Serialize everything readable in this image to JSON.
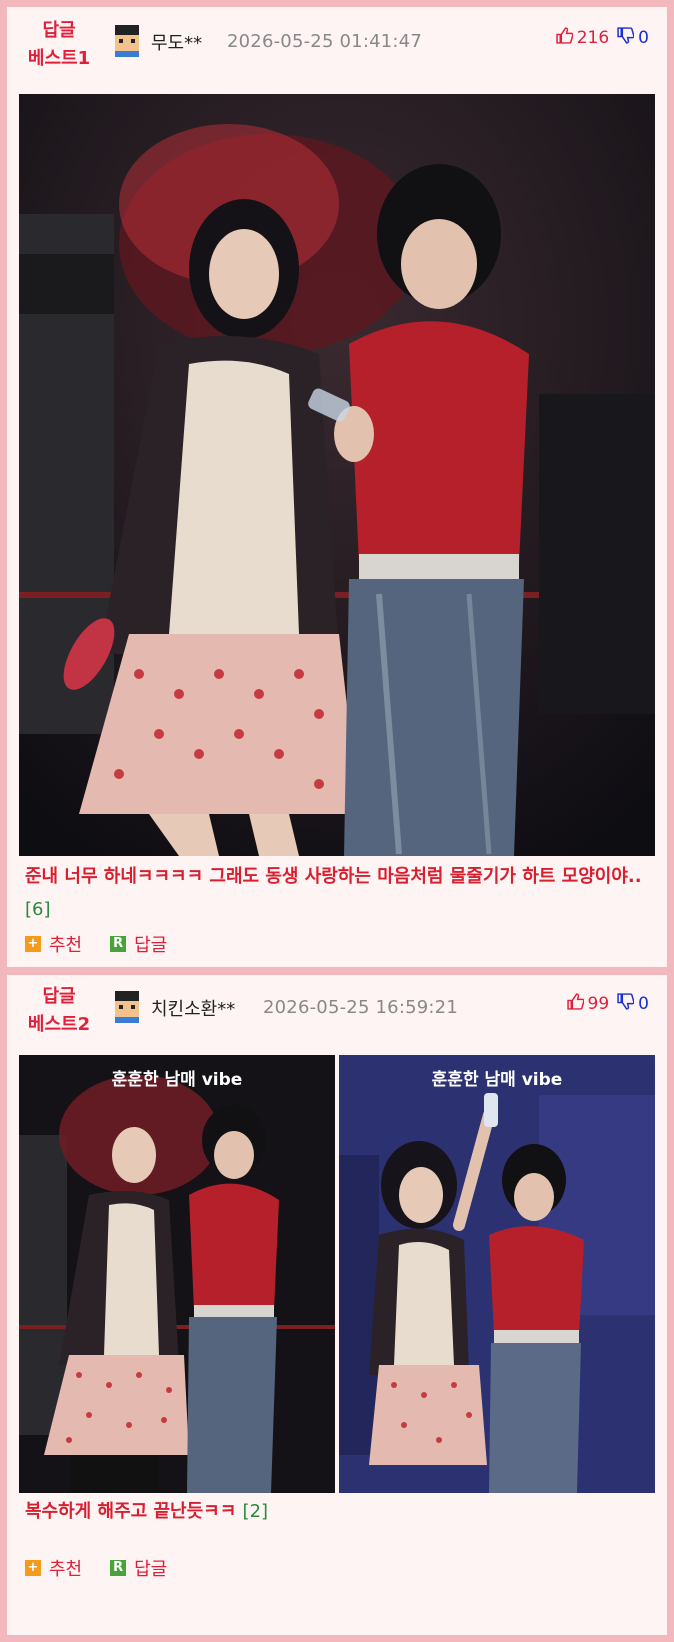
{
  "comments": [
    {
      "badge_line1": "답글",
      "badge_line2": "베스트1",
      "author": "무도**",
      "date": "2026-05-25 01:41:47",
      "up_count": "216",
      "down_count": "0",
      "text": "준내 너무 하네ㅋㅋㅋㅋ 그래도 동생 사랑하는 마음처럼 물줄기가 하트 모양이야..",
      "reply_count": "[6]",
      "recommend_label": "추천",
      "reply_label": "답글",
      "reply_icon_letter": "R",
      "recommend_icon_letter": "+"
    },
    {
      "badge_line1": "답글",
      "badge_line2": "베스트2",
      "author": "치킨소환**",
      "date": "2026-05-25 16:59:21",
      "up_count": "99",
      "down_count": "0",
      "image_caption_left": "훈훈한 남매 vibe",
      "image_caption_right": "훈훈한 남매 vibe",
      "text": "복수하게 해주고 끝난듯ㅋㅋ",
      "reply_count": "[2]",
      "recommend_label": "추천",
      "reply_label": "답글",
      "reply_icon_letter": "R",
      "recommend_icon_letter": "+"
    }
  ],
  "colors": {
    "accent_red": "#e0203a",
    "down_blue": "#1a2fcf",
    "count_green": "#2a8a3a",
    "border_pink": "#f3b8bd"
  },
  "icons": [
    "avatar-icon",
    "thumbs-up-icon",
    "thumbs-down-icon",
    "recommend-plus-icon",
    "reply-r-icon"
  ]
}
